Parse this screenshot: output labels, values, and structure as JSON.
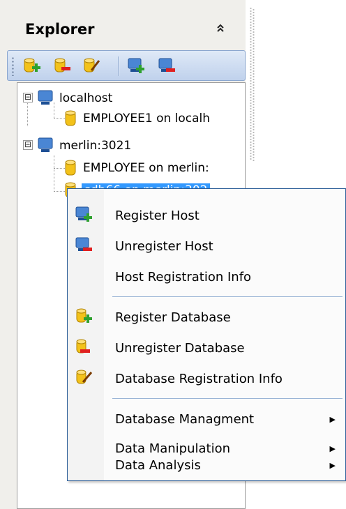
{
  "panel": {
    "title": "Explorer",
    "collapse_icon": "double-chevron-up-icon"
  },
  "toolbar": {
    "buttons": [
      {
        "name": "register-database-button",
        "icon": "database-add-icon"
      },
      {
        "name": "unregister-database-button",
        "icon": "database-remove-icon"
      },
      {
        "name": "database-registration-info-button",
        "icon": "database-edit-icon"
      },
      {
        "name": "register-host-button",
        "icon": "host-add-icon"
      },
      {
        "name": "unregister-host-button",
        "icon": "host-remove-icon"
      }
    ]
  },
  "tree": {
    "hosts": [
      {
        "label": "localhost",
        "expander": "⊟",
        "databases": [
          "EMPLOYEE1 on localh"
        ]
      },
      {
        "label": "merlin:3021",
        "expander": "⊟",
        "databases": [
          "EMPLOYEE on merlin:",
          "sdb66 on merlin:302"
        ]
      }
    ],
    "selected": "sdb66 on merlin:302"
  },
  "menu": {
    "items": [
      {
        "label": "Register Host",
        "icon": "host-add-icon"
      },
      {
        "label": "Unregister Host",
        "icon": "host-remove-icon"
      },
      {
        "label": "Host Registration Info",
        "icon": ""
      },
      {
        "label": "Register Database",
        "icon": "database-add-icon"
      },
      {
        "label": "Unregister Database",
        "icon": "database-remove-icon"
      },
      {
        "label": "Database Registration Info",
        "icon": "database-edit-icon"
      },
      {
        "label": "Database Managment",
        "icon": "",
        "submenu": true
      },
      {
        "label": "Data Manipulation",
        "icon": "",
        "submenu": true
      },
      {
        "label": "Data Analysis",
        "icon": "",
        "submenu": true
      }
    ],
    "submenu_arrow": "▶"
  }
}
